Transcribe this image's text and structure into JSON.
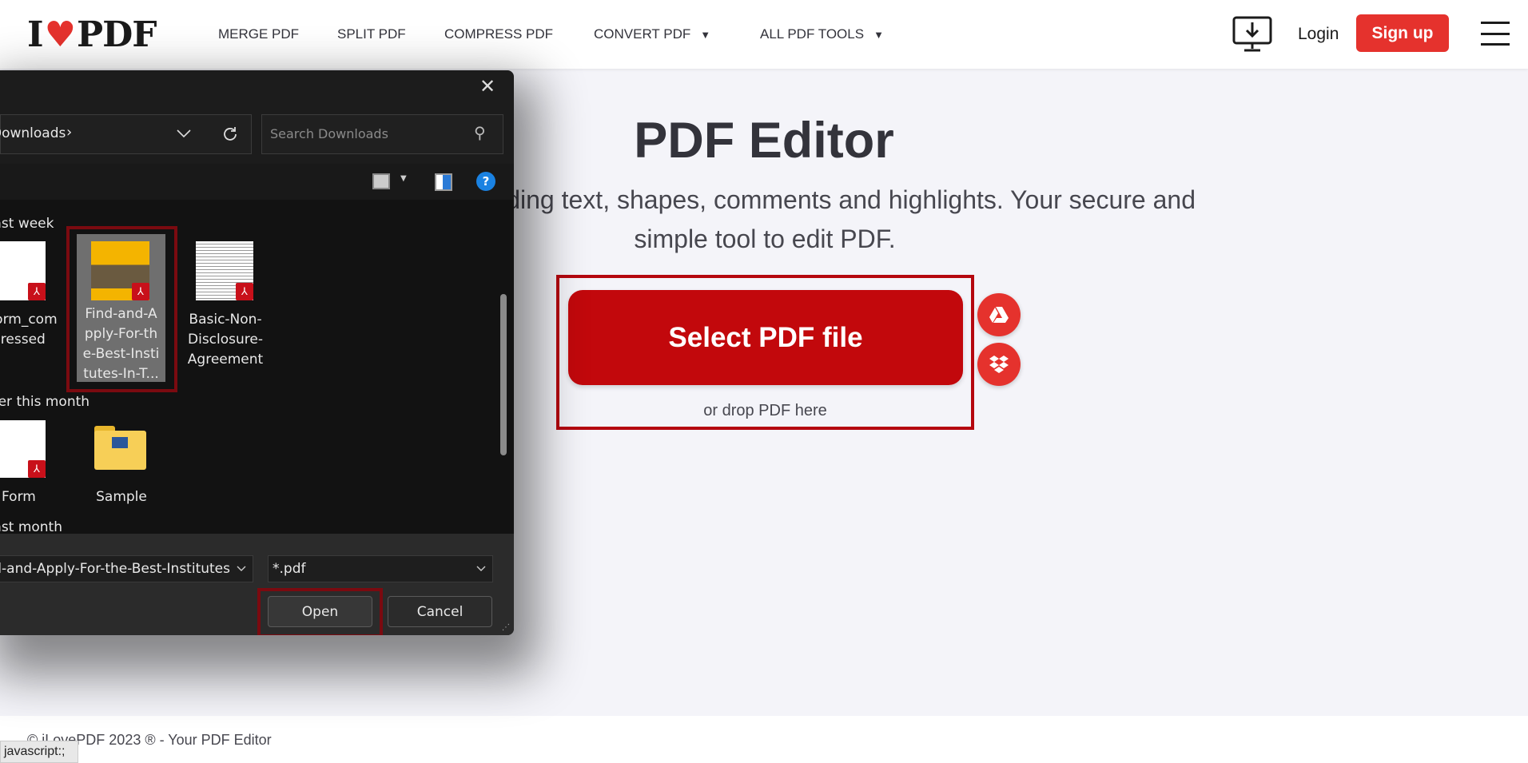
{
  "header": {
    "logo": "I♥PDF",
    "logo_text_left": "I",
    "logo_text_right": "PDF",
    "nav": [
      {
        "label": "MERGE PDF"
      },
      {
        "label": "SPLIT PDF"
      },
      {
        "label": "COMPRESS PDF"
      },
      {
        "label": "CONVERT PDF",
        "dropdown": true
      },
      {
        "label": "ALL PDF TOOLS",
        "dropdown": true
      }
    ],
    "login": "Login",
    "signup": "Sign up",
    "icons": {
      "desktop": "desktop-download-icon",
      "menu": "hamburger-menu-icon"
    }
  },
  "main": {
    "title": "PDF Editor",
    "subtitle": "Edit PDF by adding text, shapes, comments and highlights. Your secure and simple tool to edit PDF.",
    "select_button": "Select PDF file",
    "drop_text": "or drop PDF here",
    "brand_color": "#e5322d",
    "button_color": "#c2080c"
  },
  "footer": {
    "text": "© iLovePDF 2023 ® - Your PDF Editor"
  },
  "status_bar": "javascript:;",
  "dialog": {
    "address": "Downloads",
    "search_placeholder": "Search Downloads",
    "groups": [
      {
        "label": "Last week",
        "files": [
          {
            "name": "Form_compressed",
            "l1": "Form_com",
            "l2": "pressed"
          },
          {
            "name": "Find-and-Apply-For-the-Best-Institutes-In-T...",
            "l1": "Find-and-A",
            "l2": "pply-For-th",
            "l3": "e-Best-Insti",
            "l4": "tutes-In-T...",
            "selected": true
          },
          {
            "name": "Basic-Non-Disclosure-Agreement",
            "l1": "Basic-Non-",
            "l2": "Disclosure-",
            "l3": "Agreement"
          }
        ]
      },
      {
        "label": "Earlier this month",
        "files": [
          {
            "name": "Form"
          },
          {
            "name": "Sample",
            "type": "folder"
          }
        ]
      },
      {
        "label": "Last month"
      }
    ],
    "filename": "Find-and-Apply-For-the-Best-Institutes",
    "filetype": "*.pdf",
    "open": "Open",
    "cancel": "Cancel"
  }
}
